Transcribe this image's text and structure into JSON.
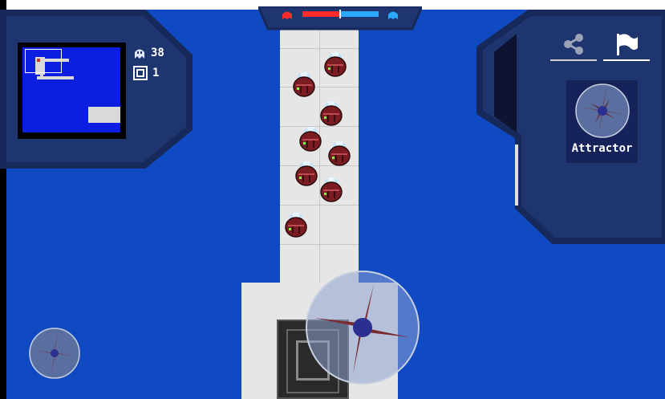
{
  "hud": {
    "enemies_remaining": "38",
    "waves": "1",
    "enemies_icon": "ghost-icon",
    "waves_icon": "wave-box-icon"
  },
  "health_bar": {
    "red_share": 0.5,
    "blue_share": 0.5,
    "red_color": "#ff2a2a",
    "blue_color": "#2aa8ff",
    "left_icon": "red-ghost-icon",
    "right_icon": "blue-ghost-icon"
  },
  "tabs": [
    {
      "icon": "share-icon",
      "active": false
    },
    {
      "icon": "flag-icon",
      "active": true
    }
  ],
  "tower": {
    "label": "Attractor",
    "icon": "attractor-shuriken-icon"
  },
  "controls": {
    "joystick_icon": "joystick-shuriken-icon",
    "small_button_icon": "small-shuriken-icon"
  },
  "colors": {
    "background": "#0f4ac2",
    "panel": "#1e3570",
    "path": "#e6e6e6",
    "enemy_body": "#7a1c22",
    "shuriken_blade": "#7a2a2e",
    "shuriken_core": "#2b2f8f"
  }
}
